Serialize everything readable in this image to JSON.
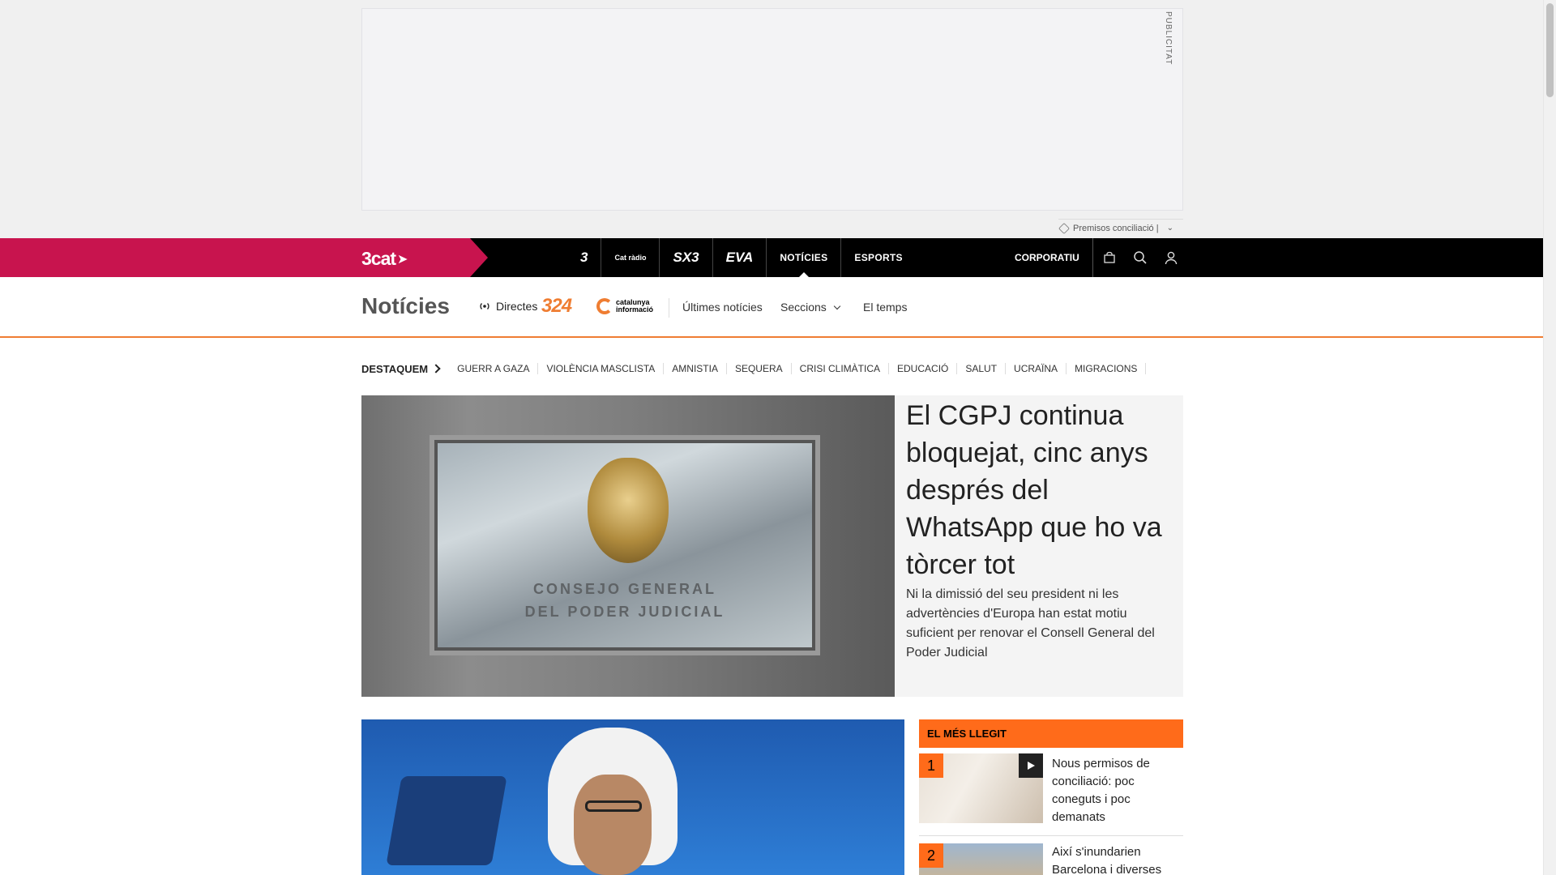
{
  "ad": {
    "label": "PUBLICITAT",
    "caption": "Premisos conciliació |"
  },
  "topnav": {
    "brand": "3cat",
    "channels": [
      {
        "label": "3",
        "name": "channel-tv3"
      },
      {
        "label": "Cat ràdio",
        "name": "channel-catradio"
      },
      {
        "label": "SX3",
        "name": "channel-sx3"
      },
      {
        "label": "EVA",
        "name": "channel-eva"
      },
      {
        "label": "NOTÍCIES",
        "name": "channel-noticies"
      },
      {
        "label": "ESPORTS",
        "name": "channel-esports"
      }
    ],
    "corporate": "CORPORATIU",
    "icons": [
      "shop-bag-icon",
      "search-icon",
      "user-icon"
    ]
  },
  "section": {
    "title": "Notícies",
    "live_label": "Directes",
    "logo_324": "324",
    "logo_ci_line1": "catalunya",
    "logo_ci_line2": "informació",
    "links": [
      "Últimes notícies",
      "Seccions",
      "El temps"
    ]
  },
  "highlights": {
    "label": "DESTAQUEM",
    "tags": [
      "GUERR A GAZA",
      "VIOLÈNCIA MASCLISTA",
      "AMNISTIA",
      "SEQUERA",
      "CRISI CLIMÀTICA",
      "EDUCACIÓ",
      "SALUT",
      "UCRAÏNA",
      "MIGRACIONS"
    ]
  },
  "featured": {
    "plaque_line1": "CONSEJO GENERAL",
    "plaque_line2": "DEL PODER JUDICIAL",
    "title": "El CGPJ continua bloquejat, cinc anys després del WhatsApp que ho va tòrcer tot",
    "summary": "Ni la dimissió del seu president ni les advertències d'Europa han estat motiu suficient per renovar el Consell General del Poder Judicial"
  },
  "most_read": {
    "header": "EL MÉS LLEGIT",
    "items": [
      {
        "rank": "1",
        "title": "Nous permisos de conciliació: poc coneguts i poc demanats"
      },
      {
        "rank": "2",
        "title": "Així s'inundarien Barcelona i diverses"
      }
    ]
  },
  "colors": {
    "brand": "#c8144e",
    "accent": "#ff6b1a",
    "nav_bg": "#000000"
  }
}
